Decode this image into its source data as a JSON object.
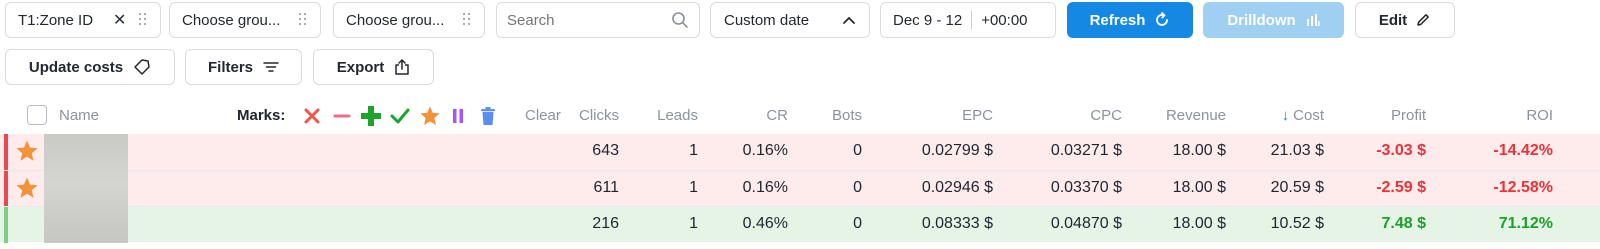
{
  "toolbar": {
    "group1": "T1:Zone ID",
    "group2": "Choose grou...",
    "group3": "Choose grou...",
    "search_placeholder": "Search",
    "date_mode": "Custom date",
    "date_range": "Dec 9 - 12",
    "timezone": "+00:00",
    "refresh": "Refresh",
    "drilldown": "Drilldown",
    "edit": "Edit",
    "update_costs": "Update costs",
    "filters": "Filters",
    "export": "Export"
  },
  "header": {
    "name": "Name",
    "marks_label": "Marks:",
    "clear": "Clear",
    "columns": [
      "Clicks",
      "Leads",
      "CR",
      "Bots",
      "EPC",
      "CPC",
      "Revenue",
      "Cost",
      "Profit",
      "ROI"
    ],
    "sort_column": "Cost",
    "sort_direction": "desc"
  },
  "marks": [
    "red-x",
    "minus",
    "green-plus",
    "check",
    "star",
    "pause",
    "trash"
  ],
  "rows": [
    {
      "status": "negative",
      "starred": true,
      "clicks": "643",
      "leads": "1",
      "cr": "0.16%",
      "bots": "0",
      "epc": "0.02799 $",
      "cpc": "0.03271 $",
      "revenue": "18.00 $",
      "cost": "21.03 $",
      "profit": "-3.03 $",
      "roi": "-14.42%"
    },
    {
      "status": "negative",
      "starred": true,
      "clicks": "611",
      "leads": "1",
      "cr": "0.16%",
      "bots": "0",
      "epc": "0.02946 $",
      "cpc": "0.03370 $",
      "revenue": "18.00 $",
      "cost": "20.59 $",
      "profit": "-2.59 $",
      "roi": "-12.58%"
    },
    {
      "status": "positive",
      "starred": false,
      "clicks": "216",
      "leads": "1",
      "cr": "0.46%",
      "bots": "0",
      "epc": "0.08333 $",
      "cpc": "0.04870 $",
      "revenue": "18.00 $",
      "cost": "10.52 $",
      "profit": "7.48 $",
      "roi": "71.12%"
    }
  ],
  "colors": {
    "primary": "#1488e3",
    "primary_disabled": "#9fd0f2",
    "negative_row": "#fdeceb",
    "positive_row": "#e5f4e5",
    "negative_text": "#e8333a",
    "positive_text": "#1ba12a",
    "star": "#f0933b"
  }
}
